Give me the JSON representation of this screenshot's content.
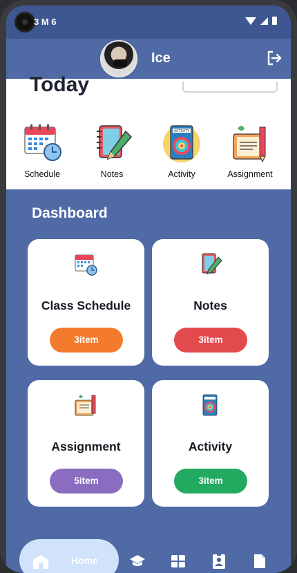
{
  "status_bar": {
    "left_text": "3  M  6"
  },
  "header": {
    "user_name": "Ice"
  },
  "top_section": {
    "title": "Today"
  },
  "quick_access": [
    {
      "label": "Schedule",
      "icon": "calendar-clock-icon"
    },
    {
      "label": "Notes",
      "icon": "notebook-pencil-icon"
    },
    {
      "label": "Activity",
      "icon": "activity-target-icon"
    },
    {
      "label": "Assignment",
      "icon": "book-pencil-icon"
    }
  ],
  "dashboard": {
    "title": "Dashboard",
    "cards": [
      {
        "title": "Class Schedule",
        "count": "3item",
        "color": "#f47a2e"
      },
      {
        "title": "Notes",
        "count": "3item",
        "color": "#e34a4e"
      },
      {
        "title": "Assignment",
        "count": "5item",
        "color": "#8a6cc0"
      },
      {
        "title": "Activity",
        "count": "3item",
        "color": "#22aa60"
      }
    ]
  },
  "bottom_nav": {
    "home_label": "Home",
    "items": [
      "graduation-cap-icon",
      "grid-icon",
      "id-badge-icon",
      "document-icon"
    ]
  }
}
